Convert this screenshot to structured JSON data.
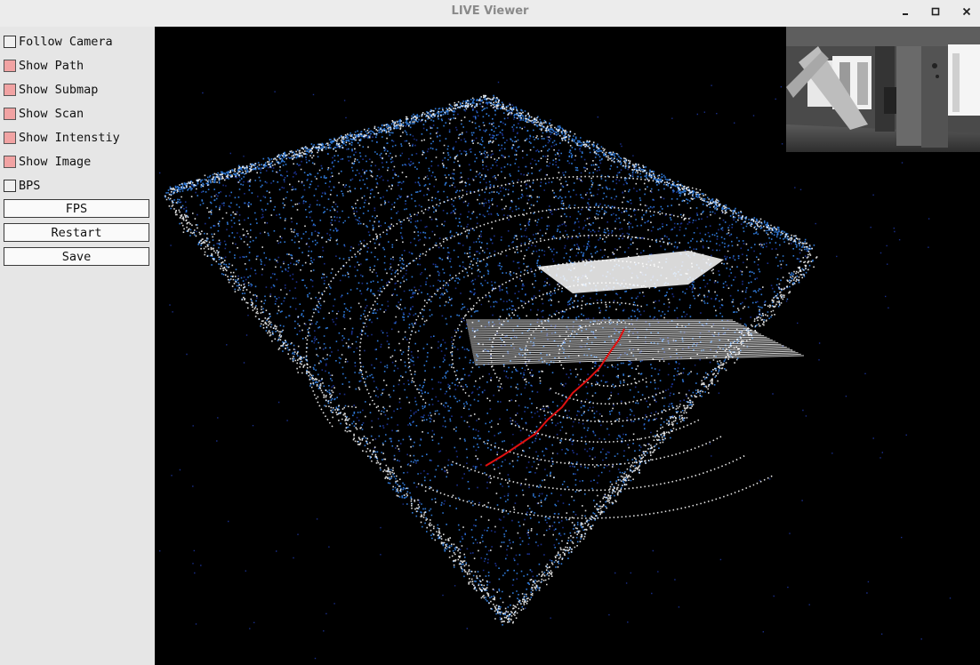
{
  "window": {
    "title": "LIVE Viewer",
    "controls": {
      "minimize": "minimize-icon",
      "maximize": "maximize-icon",
      "close": "close-icon"
    }
  },
  "sidebar": {
    "checkboxes": [
      {
        "label": "Follow Camera",
        "checked": false
      },
      {
        "label": "Show Path",
        "checked": true
      },
      {
        "label": "Show Submap",
        "checked": true
      },
      {
        "label": "Show Scan",
        "checked": true
      },
      {
        "label": "Show Intenstiy",
        "checked": true
      },
      {
        "label": "Show Image",
        "checked": true
      },
      {
        "label": "BPS",
        "checked": false
      }
    ],
    "buttons": [
      {
        "label": "FPS"
      },
      {
        "label": "Restart"
      },
      {
        "label": "Save"
      }
    ]
  },
  "colors": {
    "checked_fill": "#f1a3a3",
    "viewport_bg": "#000000",
    "points_blue": "#2f78d6",
    "points_dark_blue": "#1a2f8c",
    "points_white": "#ffffff",
    "path_red": "#e01010"
  }
}
